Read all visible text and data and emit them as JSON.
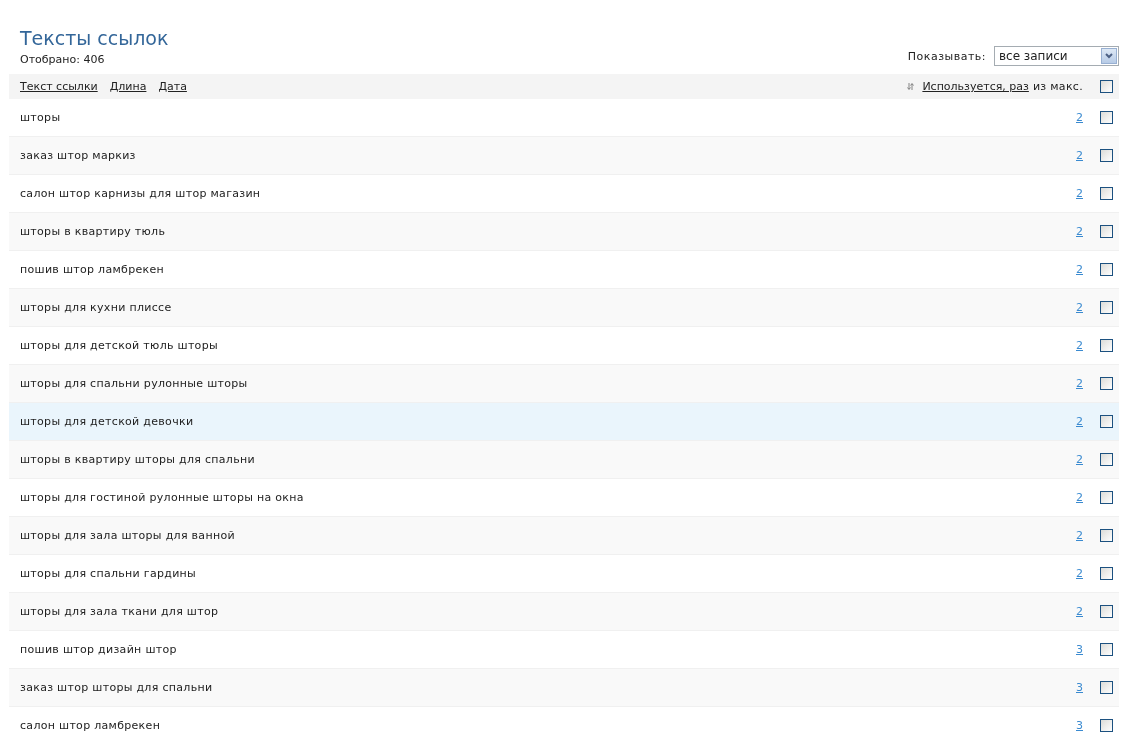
{
  "title": "Тексты ссылок",
  "count": "Отобрано: 406",
  "show": {
    "label": "Показывать:",
    "value": "все записи"
  },
  "header": {
    "sort_links": [
      "Текст ссылки",
      "Длина",
      "Дата"
    ],
    "usage_link": "Используется, раз",
    "usage_suffix": "из макс.",
    "select_all_checked": false
  },
  "rows": [
    {
      "text": "шторы",
      "count": "2",
      "checked": false,
      "highlighted": false
    },
    {
      "text": "заказ штор маркиз",
      "count": "2",
      "checked": false,
      "highlighted": false
    },
    {
      "text": "салон штор карнизы для штор магазин",
      "count": "2",
      "checked": false,
      "highlighted": false
    },
    {
      "text": "шторы в квартиру тюль",
      "count": "2",
      "checked": false,
      "highlighted": false
    },
    {
      "text": "пошив штор ламбрекен",
      "count": "2",
      "checked": false,
      "highlighted": false
    },
    {
      "text": "шторы для кухни плиссе",
      "count": "2",
      "checked": false,
      "highlighted": false
    },
    {
      "text": "шторы для детской тюль шторы",
      "count": "2",
      "checked": false,
      "highlighted": false
    },
    {
      "text": "шторы для спальни рулонные шторы",
      "count": "2",
      "checked": false,
      "highlighted": false
    },
    {
      "text": "шторы для детской девочки",
      "count": "2",
      "checked": false,
      "highlighted": true
    },
    {
      "text": "шторы в квартиру шторы для спальни",
      "count": "2",
      "checked": false,
      "highlighted": false
    },
    {
      "text": "шторы для гостиной рулонные шторы на окна",
      "count": "2",
      "checked": false,
      "highlighted": false
    },
    {
      "text": "шторы для зала шторы для ванной",
      "count": "2",
      "checked": false,
      "highlighted": false
    },
    {
      "text": "шторы для спальни гардины",
      "count": "2",
      "checked": false,
      "highlighted": false
    },
    {
      "text": "шторы для зала ткани для штор",
      "count": "2",
      "checked": false,
      "highlighted": false
    },
    {
      "text": "пошив штор дизайн штор",
      "count": "3",
      "checked": false,
      "highlighted": false
    },
    {
      "text": "заказ штор шторы для спальни",
      "count": "3",
      "checked": false,
      "highlighted": false
    },
    {
      "text": "салон штор ламбрекен",
      "count": "3",
      "checked": false,
      "highlighted": false
    }
  ]
}
